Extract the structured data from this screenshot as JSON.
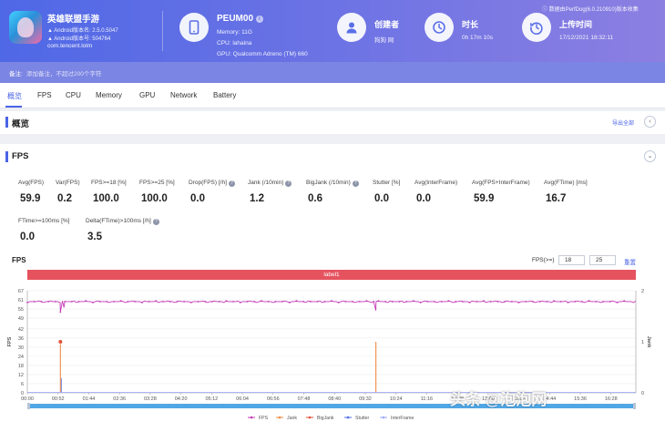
{
  "header": {
    "app": {
      "name": "英雄联盟手游",
      "android_version_label": "Android版本名: 2.5.0.5047",
      "android_code_label": "Android版本号: 504764",
      "package": "com.tencent.lolm",
      "icon": "app-game-icon"
    },
    "device": {
      "model": "PEUM00",
      "info_badge": "i",
      "memory": "Memory: 11G",
      "cpu": "CPU: lahaina",
      "gpu": "GPU: Qualcomm Adreno (TM) 660",
      "icon": "phone-icon"
    },
    "creator": {
      "label": "创建者",
      "value": "狗狗 网",
      "icon": "user-icon"
    },
    "duration": {
      "label": "时长",
      "value": "0h 17m 10s",
      "icon": "clock-icon"
    },
    "upload": {
      "label": "上传时间",
      "value": "17/12/2021 18:32:11",
      "icon": "history-icon"
    },
    "source": {
      "text": "数据由PerfDog(6.0.210910)版本收集",
      "icon": "info-icon"
    }
  },
  "note": {
    "label": "备注:",
    "placeholder": "添加备注，不超过200个字符"
  },
  "tabs": [
    "概览",
    "FPS",
    "CPU",
    "Memory",
    "GPU",
    "Network",
    "Battery"
  ],
  "overview": {
    "title": "概览",
    "export_label": "导出全部",
    "collapse_icon": "chevron-left-icon"
  },
  "fps_section": {
    "title": "FPS",
    "collapse_icon": "chevron-down-icon",
    "help_glyph": "?",
    "metrics_row1": [
      {
        "label": "Avg(FPS)",
        "value": "59.9"
      },
      {
        "label": "Var(FPS)",
        "value": "0.2"
      },
      {
        "label": "FPS>=18 [%]",
        "value": "100.0"
      },
      {
        "label": "FPS>=25 [%]",
        "value": "100.0"
      },
      {
        "label": "Drop(FPS) [/h]",
        "value": "0.0"
      },
      {
        "label": "Jank (/10min)",
        "value": "1.2"
      },
      {
        "label": "BigJank (/10min)",
        "value": "0.6"
      },
      {
        "label": "Stutter [%]",
        "value": "0.0"
      },
      {
        "label": "Avg(InterFrame)",
        "value": "0.0"
      },
      {
        "label": "Avg(FPS+InterFrame)",
        "value": "59.9"
      },
      {
        "label": "Avg(FTime) [ms]",
        "value": "16.7"
      }
    ],
    "metrics_row2": [
      {
        "label": "FTime>=100ms [%]",
        "value": "0.0"
      },
      {
        "label": "Delta(FTime)>100ms [/h]",
        "value": "3.5"
      }
    ]
  },
  "chart_panel": {
    "title": "FPS",
    "threshold_label": "FPS(>=)",
    "threshold_values": [
      "18",
      "25"
    ],
    "reset_label": "重置",
    "label_band": "label1",
    "watermark": "头条 @泡泡网"
  },
  "colors": {
    "header_start": "#4f68e6",
    "header_end": "#8c7fe2",
    "accent": "#4a63e6",
    "label_band": "#e5535f",
    "fps": "#c53ab6",
    "jank": "#ef8a45",
    "bigjank": "#e0503a",
    "stutter": "#4f6ee8",
    "interframe": "#9aa6ff"
  },
  "chart_data": {
    "type": "line",
    "title": "FPS",
    "xlabel": "",
    "ylabel": "FPS",
    "y2label": "Jank",
    "ylim": [
      0,
      67
    ],
    "y2lim": [
      0,
      2
    ],
    "yticks": [
      0,
      6,
      12,
      18,
      24,
      30,
      36,
      42,
      49,
      55,
      61,
      67
    ],
    "y2ticks": [
      0,
      1,
      2
    ],
    "xticks": [
      "00:00",
      "00:52",
      "01:44",
      "02:36",
      "03:28",
      "04:20",
      "05:12",
      "06:04",
      "06:56",
      "07:48",
      "08:40",
      "09:32",
      "10:24",
      "11:16",
      "12:08",
      "13:00",
      "13:52",
      "14:44",
      "15:36",
      "16:28"
    ],
    "x_range_seconds": [
      0,
      1030
    ],
    "grid": true,
    "legend_position": "bottom",
    "series": [
      {
        "name": "FPS",
        "type": "line",
        "baseline": 59.9,
        "dips": [
          {
            "t": 56,
            "v": 53
          },
          {
            "t": 62,
            "v": 56
          },
          {
            "t": 590,
            "v": 54
          }
        ]
      },
      {
        "name": "Jank",
        "type": "event",
        "events": [
          {
            "t": 56,
            "v": 1
          },
          {
            "t": 590,
            "v": 1
          }
        ]
      },
      {
        "name": "BigJank",
        "type": "event",
        "events": [
          {
            "t": 56,
            "v": 1
          }
        ]
      },
      {
        "name": "Stutter",
        "type": "event",
        "events": []
      },
      {
        "name": "InterFrame",
        "type": "line",
        "values": [
          0,
          0
        ]
      }
    ]
  }
}
